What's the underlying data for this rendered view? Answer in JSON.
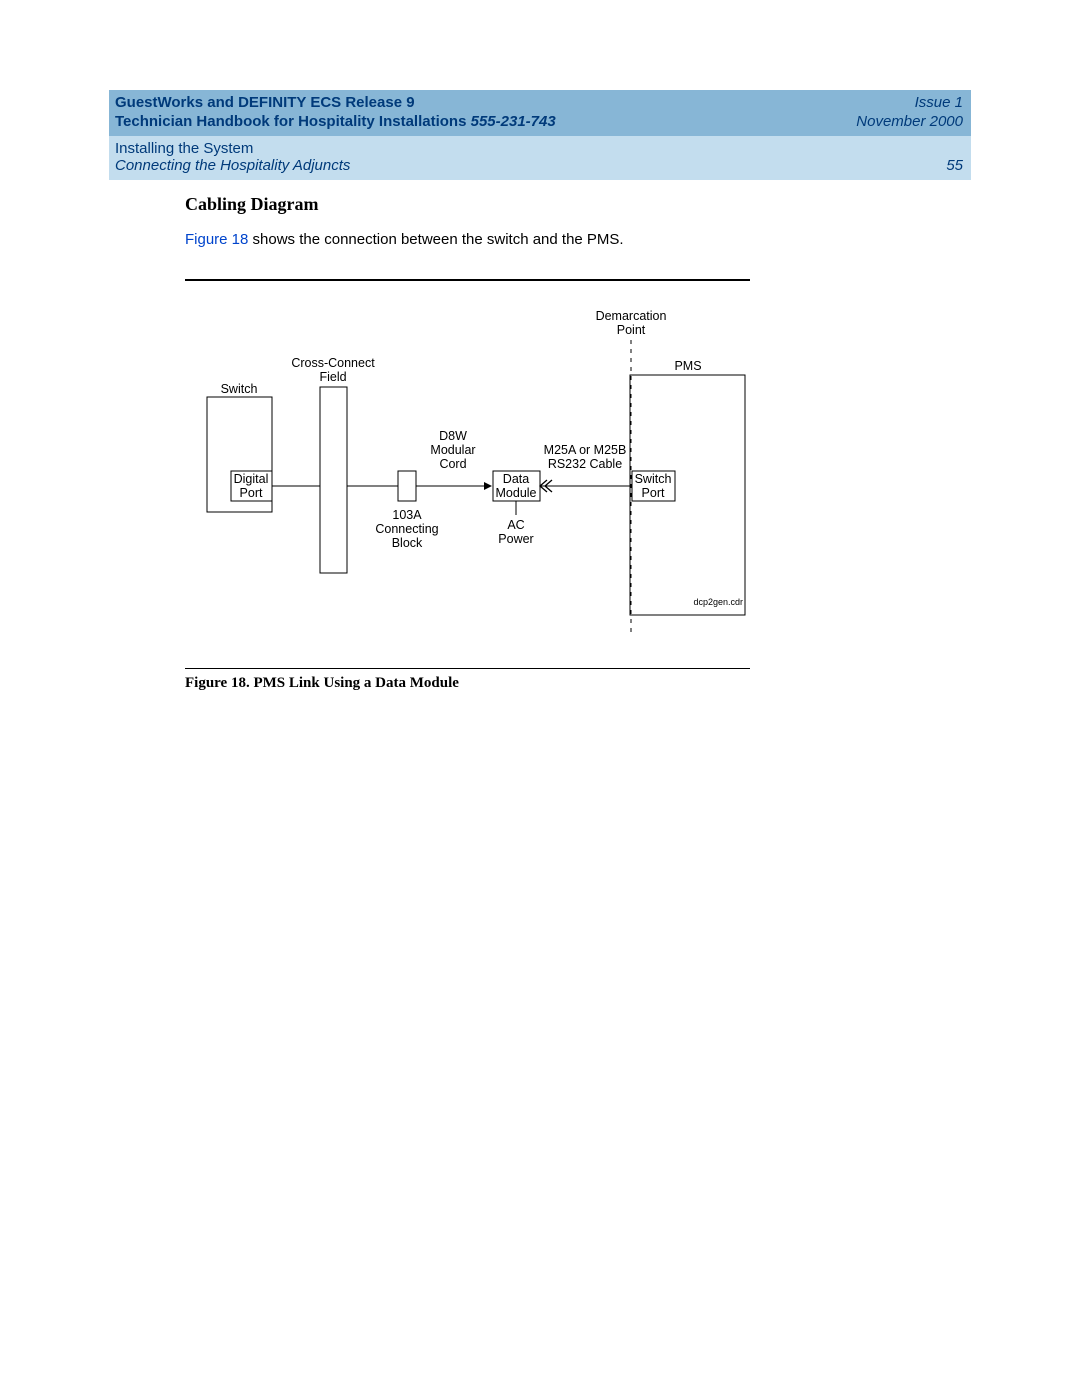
{
  "header": {
    "title_line1": "GuestWorks and DEFINITY ECS Release 9",
    "title_line2_prefix": "Technician Handbook for Hospitality Installations  ",
    "doc_number": "555-231-743",
    "issue": "Issue 1",
    "date": "November 2000",
    "chapter": "Installing the System",
    "section": "Connecting the Hospitality Adjuncts",
    "page": "55"
  },
  "body": {
    "heading": "Cabling Diagram",
    "text_before_link": "",
    "figure_link": "Figure 18",
    "text_after_link": " shows the connection between the switch and the PMS."
  },
  "figure": {
    "caption": "Figure 18.  PMS Link Using a Data Module",
    "source_tag": "dcp2gen.cdr",
    "labels": {
      "demarcation1": "Demarcation",
      "demarcation2": "Point",
      "pms": "PMS",
      "switch": "Switch",
      "xconnect1": "Cross-Connect",
      "xconnect2": "Field",
      "digital_port1": "Digital",
      "digital_port2": "Port",
      "d8w1": "D8W",
      "d8w2": "Modular",
      "d8w3": "Cord",
      "block1": "103A",
      "block2": "Connecting",
      "block3": "Block",
      "dm1": "Data",
      "dm2": "Module",
      "ac1": "AC",
      "ac2": "Power",
      "cable1": "M25A or M25B",
      "cable2": "RS232 Cable",
      "switch_port1": "Switch",
      "switch_port2": "Port"
    }
  }
}
